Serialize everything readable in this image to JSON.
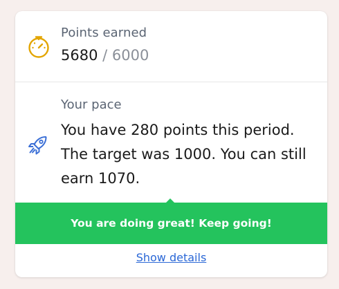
{
  "points": {
    "label": "Points earned",
    "earned": "5680",
    "separator": " / ",
    "total": "6000",
    "icon": "speedometer-icon",
    "icon_color": "#e3a500"
  },
  "pace": {
    "label": "Your pace",
    "text": "You have 280 points this period. The target was 1000. You can still earn 1070.",
    "icon": "rocket-icon",
    "icon_color": "#3b6fd6"
  },
  "banner": {
    "message": "You are doing great! Keep going!",
    "color": "#24c35d"
  },
  "footer": {
    "link_label": "Show details",
    "link_color": "#2a67d6"
  }
}
